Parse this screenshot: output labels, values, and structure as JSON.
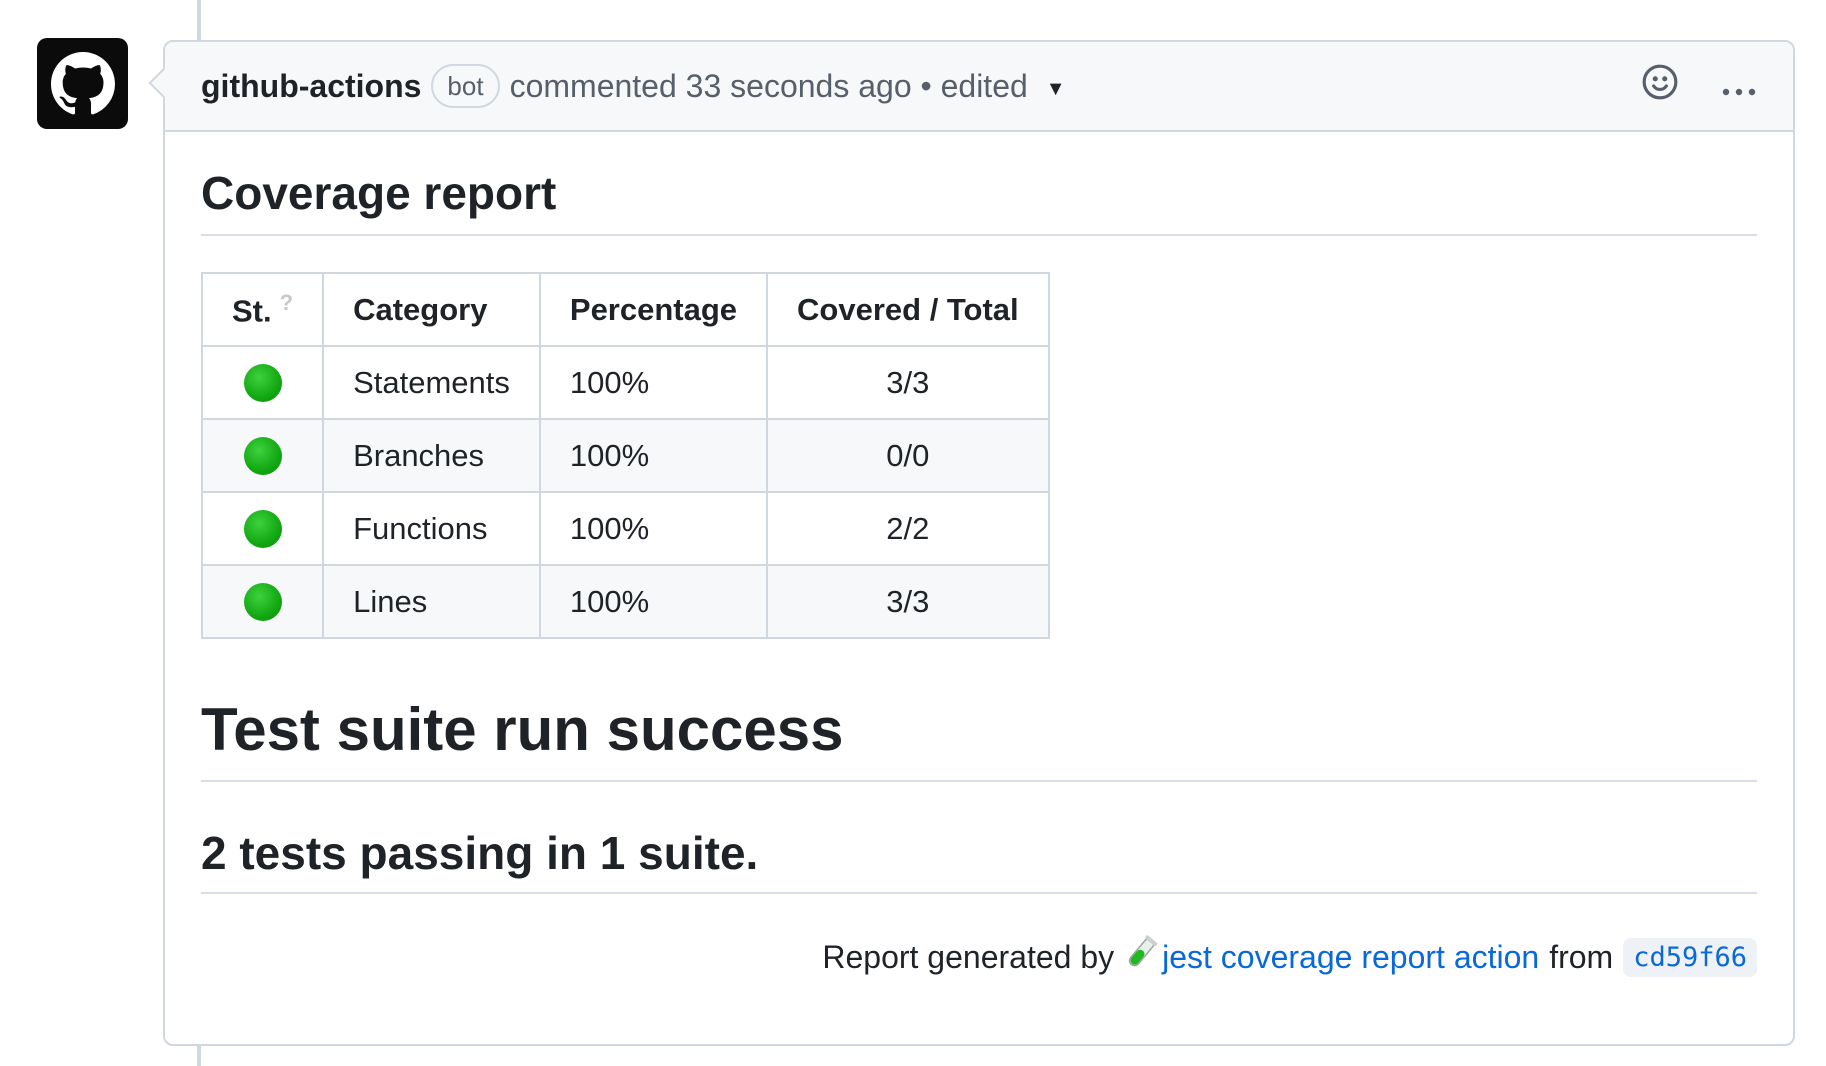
{
  "comment": {
    "author": "github-actions",
    "badge": "bot",
    "meta": "commented 33 seconds ago • edited",
    "icons": {
      "avatar": "github-octocat-icon",
      "reaction": "smiley-icon",
      "more": "kebab-horizontal-icon",
      "caret": "triangle-down-icon"
    }
  },
  "report": {
    "coverage_title": "Coverage report",
    "table": {
      "headers": [
        "St.",
        "Category",
        "Percentage",
        "Covered / Total"
      ],
      "help_mark": "?",
      "rows": [
        {
          "status": "green",
          "category": "Statements",
          "percentage": "100%",
          "covered": "3/3"
        },
        {
          "status": "green",
          "category": "Branches",
          "percentage": "100%",
          "covered": "0/0"
        },
        {
          "status": "green",
          "category": "Functions",
          "percentage": "100%",
          "covered": "2/2"
        },
        {
          "status": "green",
          "category": "Lines",
          "percentage": "100%",
          "covered": "3/3"
        }
      ]
    },
    "suite_title": "Test suite run success",
    "passing_title": "2 tests passing in 1 suite.",
    "footer": {
      "prefix": "Report generated by",
      "link_text": "jest coverage report action",
      "from": "from",
      "sha": "cd59f66"
    }
  },
  "colors": {
    "status_green": "#12a812",
    "link": "#0969da",
    "border": "#d0d7de"
  }
}
